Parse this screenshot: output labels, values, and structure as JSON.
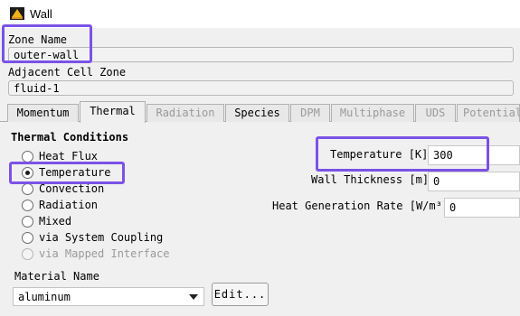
{
  "window": {
    "title": "Wall",
    "icon": "fluent-app-icon"
  },
  "zone": {
    "name_label": "Zone Name",
    "name_value": "outer-wall",
    "adjacent_label": "Adjacent Cell Zone",
    "adjacent_value": "fluid-1"
  },
  "tabs": [
    {
      "label": "Momentum",
      "enabled": true,
      "active": false
    },
    {
      "label": "Thermal",
      "enabled": true,
      "active": true
    },
    {
      "label": "Radiation",
      "enabled": false,
      "active": false
    },
    {
      "label": "Species",
      "enabled": true,
      "active": false
    },
    {
      "label": "DPM",
      "enabled": false,
      "active": false
    },
    {
      "label": "Multiphase",
      "enabled": false,
      "active": false
    },
    {
      "label": "UDS",
      "enabled": false,
      "active": false
    },
    {
      "label": "Potential",
      "enabled": false,
      "active": false
    }
  ],
  "thermal": {
    "section_title": "Thermal Conditions",
    "options": [
      {
        "label": "Heat Flux",
        "checked": false,
        "enabled": true
      },
      {
        "label": "Temperature",
        "checked": true,
        "enabled": true
      },
      {
        "label": "Convection",
        "checked": false,
        "enabled": true
      },
      {
        "label": "Radiation",
        "checked": false,
        "enabled": true
      },
      {
        "label": "Mixed",
        "checked": false,
        "enabled": true
      },
      {
        "label": "via System Coupling",
        "checked": false,
        "enabled": true
      },
      {
        "label": "via Mapped Interface",
        "checked": false,
        "enabled": false
      }
    ],
    "temperature_label": "Temperature [K]",
    "temperature_value": "300",
    "wall_thickness_label": "Wall Thickness [m]",
    "wall_thickness_value": "0",
    "heat_gen_label": "Heat Generation Rate [W/m³]",
    "heat_gen_value": "0"
  },
  "material": {
    "label": "Material Name",
    "selected": "aluminum",
    "edit_label": "Edit..."
  },
  "colors": {
    "highlight": "#7b52e6",
    "icon_body": "#f2b31b",
    "icon_bg": "#1c1c1c"
  }
}
